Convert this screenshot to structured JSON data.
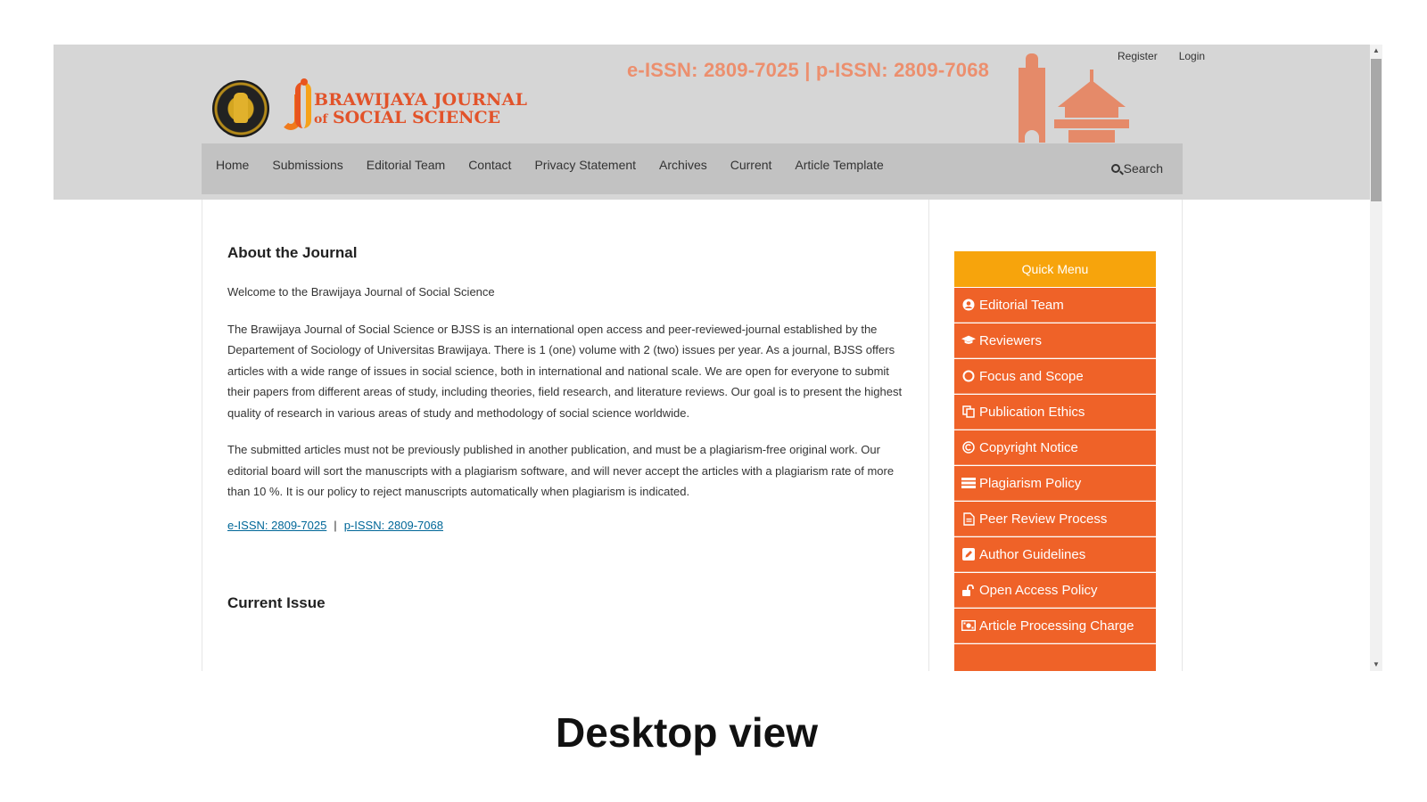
{
  "header": {
    "user_nav": [
      "Register",
      "Login"
    ],
    "brand_line1": "BRAWIJAYA JOURNAL",
    "brand_of": "of",
    "brand_line2": "SOCIAL SCIENCE",
    "issn_banner": "e-ISSN: 2809-7025 | p-ISSN: 2809-7068"
  },
  "nav": {
    "items": [
      "Home",
      "Submissions",
      "Editorial Team",
      "Contact",
      "Privacy Statement",
      "Archives",
      "Current",
      "Article Template"
    ],
    "search_label": "Search"
  },
  "main": {
    "about_title": "About the Journal",
    "welcome": "Welcome to the Brawijaya Journal of Social Science",
    "para1": "The Brawijaya Journal of Social Science or BJSS is an international open access and peer-reviewed-journal established by the Departement of Sociology of Universitas Brawijaya. There is 1 (one) volume with 2 (two) issues per year. As a journal, BJSS offers articles with a wide range of issues in social science, both in international and national scale. We are open for everyone to submit their papers from different areas of study, including theories, field research, and literature reviews. Our goal is to present the highest quality of research in various areas of study and methodology of social science worldwide.",
    "para2": "The submitted articles must not be previously published in another publication, and must be a plagiarism-free original work. Our editorial board will sort the manuscripts with a plagiarism software, and will never accept the articles with a plagiarism rate of more than 10 %. It is our policy to reject manuscripts automatically when plagiarism is indicated.",
    "eissn_link": "e-ISSN: 2809-7025",
    "separator": "|",
    "pissn_link": "p-ISSN: 2809-7068",
    "current_issue_title": "Current Issue"
  },
  "sidebar": {
    "title": "Quick Menu",
    "items": [
      {
        "label": "Editorial Team",
        "icon": "user-circle-icon"
      },
      {
        "label": "Reviewers",
        "icon": "graduation-cap-icon"
      },
      {
        "label": "Focus and Scope",
        "icon": "circle-icon"
      },
      {
        "label": "Publication Ethics",
        "icon": "copy-icon"
      },
      {
        "label": "Copyright Notice",
        "icon": "copyright-icon"
      },
      {
        "label": "Plagiarism Policy",
        "icon": "server-icon"
      },
      {
        "label": "Peer Review Process",
        "icon": "file-text-icon"
      },
      {
        "label": "Author Guidelines",
        "icon": "pencil-square-icon"
      },
      {
        "label": "Open Access Policy",
        "icon": "unlock-icon"
      },
      {
        "label": "Article Processing Charge",
        "icon": "money-icon"
      }
    ]
  },
  "caption": "Desktop view",
  "colors": {
    "header_bg": "#d6d6d6",
    "navbar_bg": "#c2c2c2",
    "brand": "#e2532a",
    "quick_menu_title": "#f7a40c",
    "quick_menu_item": "#ef6228",
    "link": "#006798"
  }
}
